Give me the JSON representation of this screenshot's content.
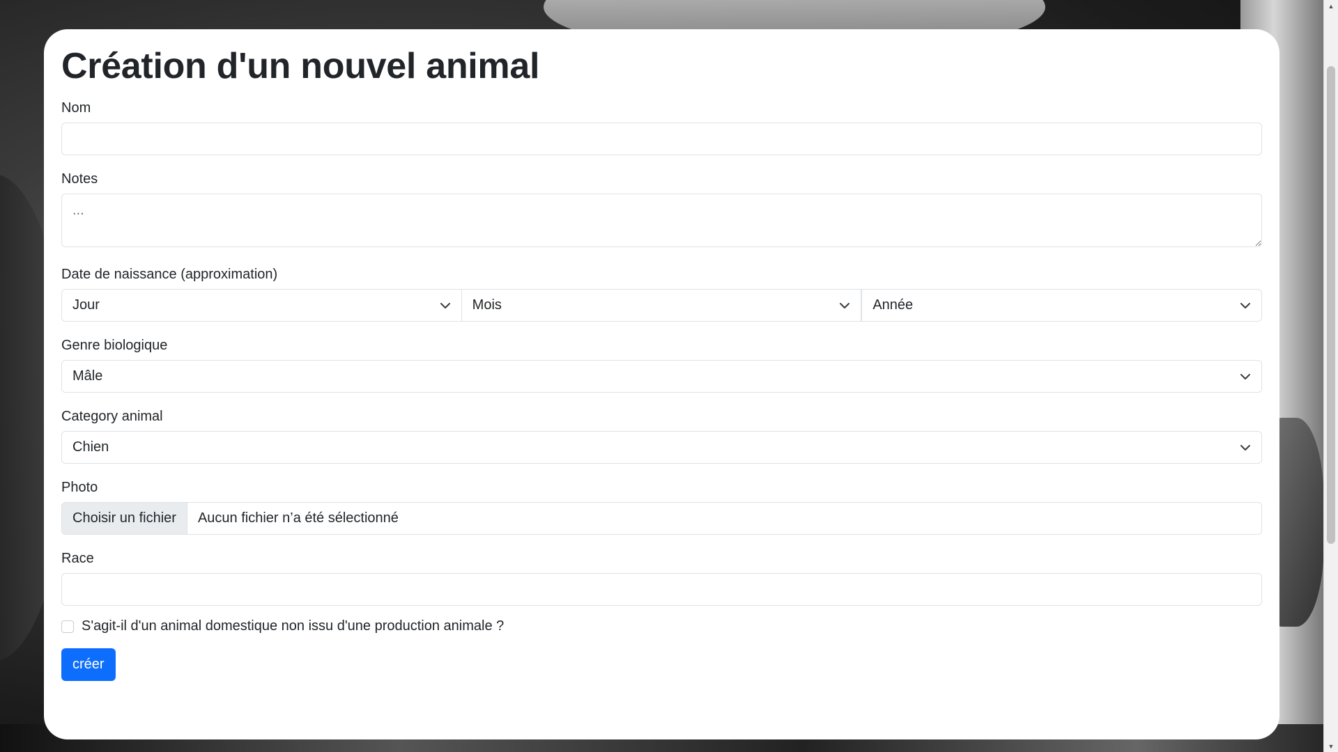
{
  "page": {
    "title": "Création d'un nouvel animal"
  },
  "form": {
    "nom": {
      "label": "Nom",
      "value": ""
    },
    "notes": {
      "label": "Notes",
      "placeholder": "...",
      "value": ""
    },
    "birthdate": {
      "label": "Date de naissance (approximation)",
      "day": "Jour",
      "month": "Mois",
      "year": "Année"
    },
    "gender": {
      "label": "Genre biologique",
      "selected": "Mâle"
    },
    "category": {
      "label": "Category animal",
      "selected": "Chien"
    },
    "photo": {
      "label": "Photo",
      "button": "Choisir un fichier",
      "status": "Aucun fichier n’a été sélectionné"
    },
    "race": {
      "label": "Race",
      "value": ""
    },
    "domestic": {
      "label": "S'agit-il d'un animal domestique non issu d'une production animale ?",
      "checked": false
    },
    "submit": {
      "label": "créer"
    }
  },
  "colors": {
    "primary": "#0d6efd",
    "border": "#dee2e6",
    "text": "#212529",
    "file_button_bg": "#e9ecef"
  },
  "icons": {
    "select": "chevron-down-icon",
    "scroll_up": "triangle-up-icon",
    "scroll_down": "triangle-down-icon"
  }
}
